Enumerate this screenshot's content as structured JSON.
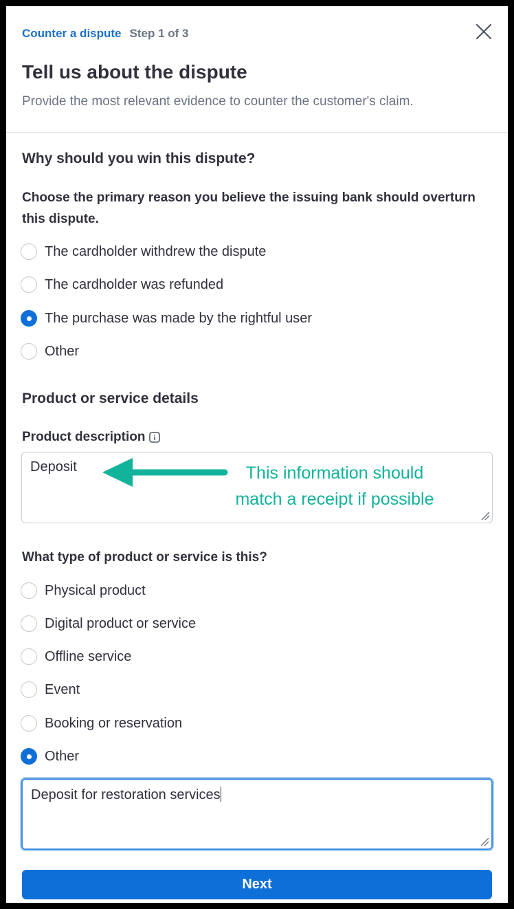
{
  "header": {
    "breadcrumb_link": "Counter a dispute",
    "step": "Step 1 of 3",
    "title": "Tell us about the dispute",
    "subtitle": "Provide the most relevant evidence to counter the customer's claim."
  },
  "win_section": {
    "title": "Why should you win this dispute?",
    "question": "Choose the primary reason you believe the issuing bank should overturn this dispute.",
    "options": [
      {
        "label": "The cardholder withdrew the dispute",
        "checked": false
      },
      {
        "label": "The cardholder was refunded",
        "checked": false
      },
      {
        "label": "The purchase was made by the rightful user",
        "checked": true
      },
      {
        "label": "Other",
        "checked": false
      }
    ]
  },
  "product_section": {
    "title": "Product or service details",
    "description_label": "Product description",
    "description_value": "Deposit",
    "annotation_line1": "This information should",
    "annotation_line2": "match a receipt if possible",
    "type_question": "What type of product or service is this?",
    "type_options": [
      {
        "label": "Physical product",
        "checked": false
      },
      {
        "label": "Digital product or service",
        "checked": false
      },
      {
        "label": "Offline service",
        "checked": false
      },
      {
        "label": "Event",
        "checked": false
      },
      {
        "label": "Booking or reservation",
        "checked": false
      },
      {
        "label": "Other",
        "checked": true
      }
    ],
    "other_value": "Deposit for restoration services"
  },
  "footer": {
    "next_label": "Next"
  },
  "colors": {
    "accent": "#0e6fd8",
    "link": "#1a6fc9",
    "annotation": "#12b39b"
  },
  "icons": [
    "close-icon",
    "info-icon",
    "resize-grip-icon",
    "arrow-annotation-icon"
  ]
}
